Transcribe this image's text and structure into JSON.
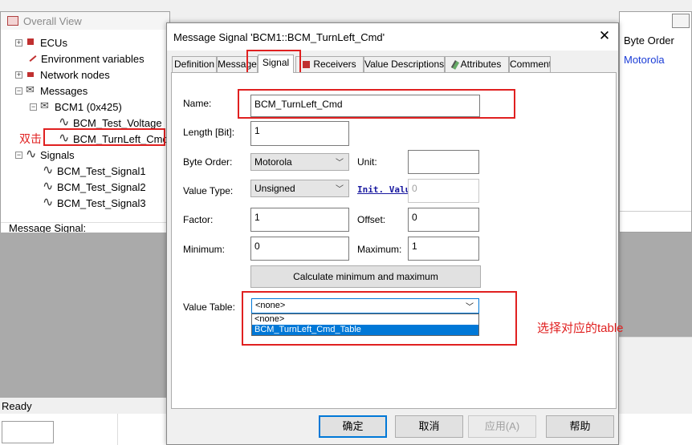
{
  "overall_view": {
    "title": "Overall View",
    "tree": [
      {
        "label": "ECUs",
        "icon": "ecu-icon",
        "expander": "+"
      },
      {
        "label": "Environment variables",
        "icon": "env-var-icon",
        "expander": ""
      },
      {
        "label": "Network nodes",
        "icon": "network-node-icon",
        "expander": "+"
      },
      {
        "label": "Messages",
        "icon": "message-icon",
        "expander": "−"
      },
      {
        "label": "BCM1 (0x425)",
        "icon": "message-icon",
        "expander": "−"
      },
      {
        "label": "BCM_Test_Voltage",
        "icon": "signal-icon",
        "expander": ""
      },
      {
        "label": "BCM_TurnLeft_Cmd",
        "icon": "signal-icon",
        "expander": ""
      },
      {
        "label": "Signals",
        "icon": "signal-icon",
        "expander": "−"
      },
      {
        "label": "BCM_Test_Signal1",
        "icon": "signal-icon",
        "expander": ""
      },
      {
        "label": "BCM_Test_Signal2",
        "icon": "signal-icon",
        "expander": ""
      },
      {
        "label": "BCM_Test_Signal3",
        "icon": "signal-icon",
        "expander": ""
      }
    ],
    "status": "Message Signal: BCM_TurnLeft_Cmd",
    "annotation_dblclick": "双击"
  },
  "right_panel": {
    "header": "Byte Order",
    "value": "Motorola"
  },
  "statusbar": {
    "text": "Ready"
  },
  "dialog": {
    "title": "Message Signal 'BCM1::BCM_TurnLeft_Cmd'",
    "close_glyph": "✕",
    "tabs": [
      {
        "label": "Definition",
        "active": false
      },
      {
        "label": "Message",
        "active": false
      },
      {
        "label": "Signal",
        "active": true
      },
      {
        "label": "Receivers",
        "active": false
      },
      {
        "label": "Value Descriptions",
        "active": false
      },
      {
        "label": "Attributes",
        "active": false
      },
      {
        "label": "Comment",
        "active": false
      }
    ],
    "signal": {
      "name_label": "Name:",
      "name_value": "BCM_TurnLeft_Cmd",
      "length_label": "Length [Bit]:",
      "length_value": "1",
      "byte_order_label": "Byte Order:",
      "byte_order_value": "Motorola",
      "unit_label": "Unit:",
      "unit_value": "",
      "value_type_label": "Value Type:",
      "value_type_value": "Unsigned",
      "init_value_link": "Init. Value",
      "init_value_value": "0",
      "factor_label": "Factor:",
      "factor_value": "1",
      "offset_label": "Offset:",
      "offset_value": "0",
      "minimum_label": "Minimum:",
      "minimum_value": "0",
      "maximum_label": "Maximum:",
      "maximum_value": "1",
      "calc_button": "Calculate minimum and maximum",
      "value_table_label": "Value Table:",
      "value_table_value": "<none>",
      "value_table_options": [
        "<none>",
        "BCM_TurnLeft_Cmd_Table"
      ],
      "value_table_selected_index": 1,
      "annotation_select": "选择对应的table"
    },
    "buttons": {
      "ok": "确定",
      "cancel": "取消",
      "apply": "应用(A)",
      "help": "帮助"
    }
  },
  "colors": {
    "annotation_red": "#e02020",
    "selection_blue": "#0078d7",
    "link_blue": "#1a3cd6"
  }
}
